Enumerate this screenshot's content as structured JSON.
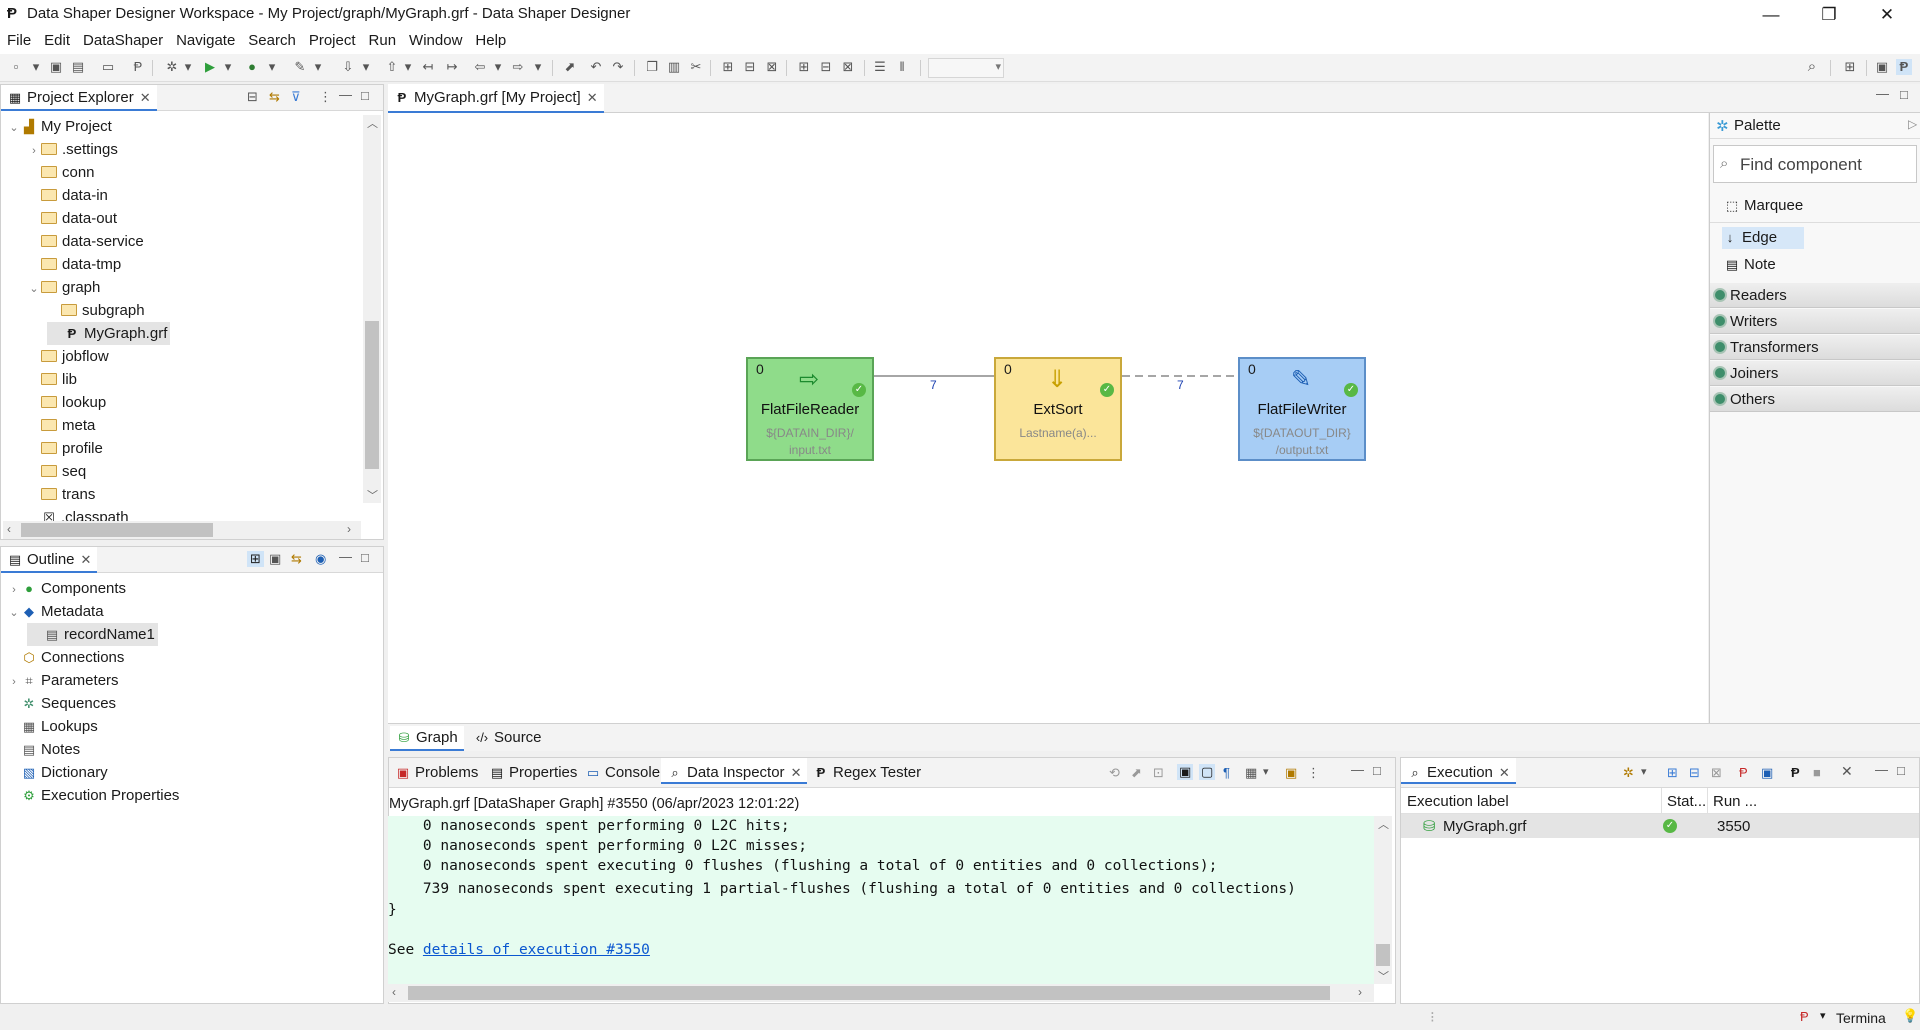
{
  "window": {
    "title": "Data Shaper Designer Workspace - My Project/graph/MyGraph.grf - Data Shaper Designer",
    "minimize": "—",
    "restore": "❐",
    "close": "✕"
  },
  "menu": [
    "File",
    "Edit",
    "DataShaper",
    "Navigate",
    "Search",
    "Project",
    "Run",
    "Window",
    "Help"
  ],
  "project_explorer": {
    "tab_label": "Project Explorer",
    "items": [
      {
        "label": "My Project",
        "level": 0,
        "type": "project",
        "expanded": true
      },
      {
        "label": ".settings",
        "level": 1,
        "type": "folder",
        "twisty": "›"
      },
      {
        "label": "conn",
        "level": 1,
        "type": "folder"
      },
      {
        "label": "data-in",
        "level": 1,
        "type": "folder"
      },
      {
        "label": "data-out",
        "level": 1,
        "type": "folder"
      },
      {
        "label": "data-service",
        "level": 1,
        "type": "folder"
      },
      {
        "label": "data-tmp",
        "level": 1,
        "type": "folder"
      },
      {
        "label": "graph",
        "level": 1,
        "type": "folder",
        "twisty": "⌄"
      },
      {
        "label": "subgraph",
        "level": 2,
        "type": "folder"
      },
      {
        "label": "MyGraph.grf",
        "level": 2,
        "type": "file",
        "selected": true
      },
      {
        "label": "jobflow",
        "level": 1,
        "type": "folder"
      },
      {
        "label": "lib",
        "level": 1,
        "type": "folder"
      },
      {
        "label": "lookup",
        "level": 1,
        "type": "folder"
      },
      {
        "label": "meta",
        "level": 1,
        "type": "folder"
      },
      {
        "label": "profile",
        "level": 1,
        "type": "folder"
      },
      {
        "label": "seq",
        "level": 1,
        "type": "folder"
      },
      {
        "label": "trans",
        "level": 1,
        "type": "folder"
      },
      {
        "label": ".classpath",
        "level": 1,
        "type": "xfile"
      }
    ]
  },
  "outline": {
    "tab_label": "Outline",
    "items": [
      {
        "label": "Components",
        "level": 0,
        "twisty": "›"
      },
      {
        "label": "Metadata",
        "level": 0,
        "twisty": "⌄"
      },
      {
        "label": "recordName1",
        "level": 1,
        "selected": true
      },
      {
        "label": "Connections",
        "level": 0
      },
      {
        "label": "Parameters",
        "level": 0,
        "twisty": "›"
      },
      {
        "label": "Sequences",
        "level": 0
      },
      {
        "label": "Lookups",
        "level": 0
      },
      {
        "label": "Notes",
        "level": 0
      },
      {
        "label": "Dictionary",
        "level": 0
      },
      {
        "label": "Execution Properties",
        "level": 0
      }
    ]
  },
  "editor": {
    "tab_label": "MyGraph.grf [My Project]",
    "bottom_tabs": [
      "Graph",
      "Source"
    ],
    "nodes": [
      {
        "name": "FlatFileReader",
        "sub1": "${DATAIN_DIR}/",
        "sub2": "input.txt",
        "port": "0",
        "color": "#8fdc8a",
        "border": "#5aa456"
      },
      {
        "name": "ExtSort",
        "sub1": "Lastname(a)...",
        "sub2": "",
        "port": "0",
        "color": "#fbe59a",
        "border": "#c9a83a"
      },
      {
        "name": "FlatFileWriter",
        "sub1": "${DATAOUT_DIR}",
        "sub2": "/output.txt",
        "port": "0",
        "color": "#a7cdf5",
        "border": "#5c8ec8"
      }
    ],
    "edges": [
      {
        "label": "7"
      },
      {
        "label": "7"
      }
    ]
  },
  "palette": {
    "title": "Palette",
    "search_placeholder": "Find component",
    "tools": [
      "Marquee",
      "Edge",
      "Note"
    ],
    "drawers": [
      "Readers",
      "Writers",
      "Transformers",
      "Joiners",
      "Others"
    ]
  },
  "bottom_panel": {
    "tabs": [
      "Problems",
      "Properties",
      "Console",
      "Data Inspector",
      "Regex Tester"
    ],
    "header": "MyGraph.grf [DataShaper Graph] #3550 (06/apr/2023 12:01:22)",
    "lines": [
      "    0 nanoseconds spent performing 0 L2C hits;",
      "    0 nanoseconds spent performing 0 L2C misses;",
      "    0 nanoseconds spent executing 0 flushes (flushing a total of 0 entities and 0 collections);",
      "    739 nanoseconds spent executing 1 partial-flushes (flushing a total of 0 entities and 0 collections)",
      "}"
    ],
    "see_prefix": "See ",
    "link": "details of execution #3550"
  },
  "execution": {
    "tab_label": "Execution",
    "columns": [
      "Execution label",
      "Stat...",
      "Run ..."
    ],
    "rows": [
      {
        "label": "MyGraph.grf",
        "status": "ok",
        "run": "3550"
      }
    ]
  },
  "status_bar": {
    "terminal": "Termina"
  }
}
